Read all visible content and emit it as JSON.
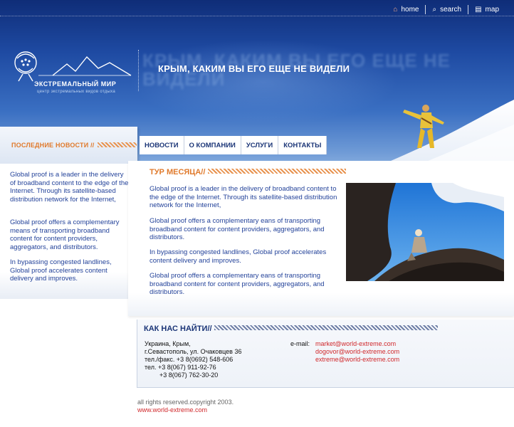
{
  "top_nav": {
    "home": "home",
    "search": "search",
    "map": "map"
  },
  "logo": {
    "title": "ЭКСТРЕМАЛЬНЫЙ МИР",
    "subtitle": "центр экстремальных видов отдыха"
  },
  "slogan": "КРЫМ, КАКИМ ВЫ ЕГО ЕЩЕ НЕ ВИДЕЛИ",
  "sidebar": {
    "title": "ПОСЛЕДНИЕ НОВОСТИ //",
    "paragraphs": [
      "Global proof is a leader in the delivery of broadband content to the edge of the Internet. Through its satellite-based distribution network for the Internet,",
      "Global proof offers a complementary means of transporting broadband content for content providers, aggregators, and distributors.",
      "In bypassing congested landlines, Global proof accelerates content delivery and improves."
    ]
  },
  "main_nav": [
    "НОВОСТИ",
    "О КОМПАНИИ",
    "УСЛУГИ",
    "КОНТАКТЫ"
  ],
  "tour": {
    "title": "ТУР МЕСЯЦА//",
    "paragraphs": [
      "Global proof is a leader in the delivery of broadband content to the edge of the Internet. Through its satellite-based distribution network for the Internet,",
      "Global proof offers a complementary eans of transporting broadband content for content providers, aggregators, and distributors.",
      "In bypassing congested landlines, Global proof accelerates content delivery and improves.",
      "Global proof offers a complementary eans of transporting broadband content for content providers, aggregators, and distributors."
    ]
  },
  "contacts": {
    "title": "КАК НАС НАЙТИ//",
    "address": [
      "Украина, Крым,",
      "г.Севастополь, ул. Очаковцев 36",
      "тел./факс. +3 8(0692) 548-606",
      "тел.  +3 8(067) 911-92-76",
      "+3 8(067) 762-30-20"
    ],
    "email_label": "e-mail:",
    "emails": [
      "market@world-extreme.com",
      "dogovor@world-extreme.com",
      "extreme@world-extreme.com"
    ]
  },
  "footer": {
    "copyright": "all rights reserved.copyright 2003.",
    "site": "www.world-extreme.com"
  },
  "colors": {
    "header_blue": "#1e4aa2",
    "accent_orange": "#e07a2c",
    "link_red": "#d0282b",
    "text_blue": "#24439a"
  }
}
